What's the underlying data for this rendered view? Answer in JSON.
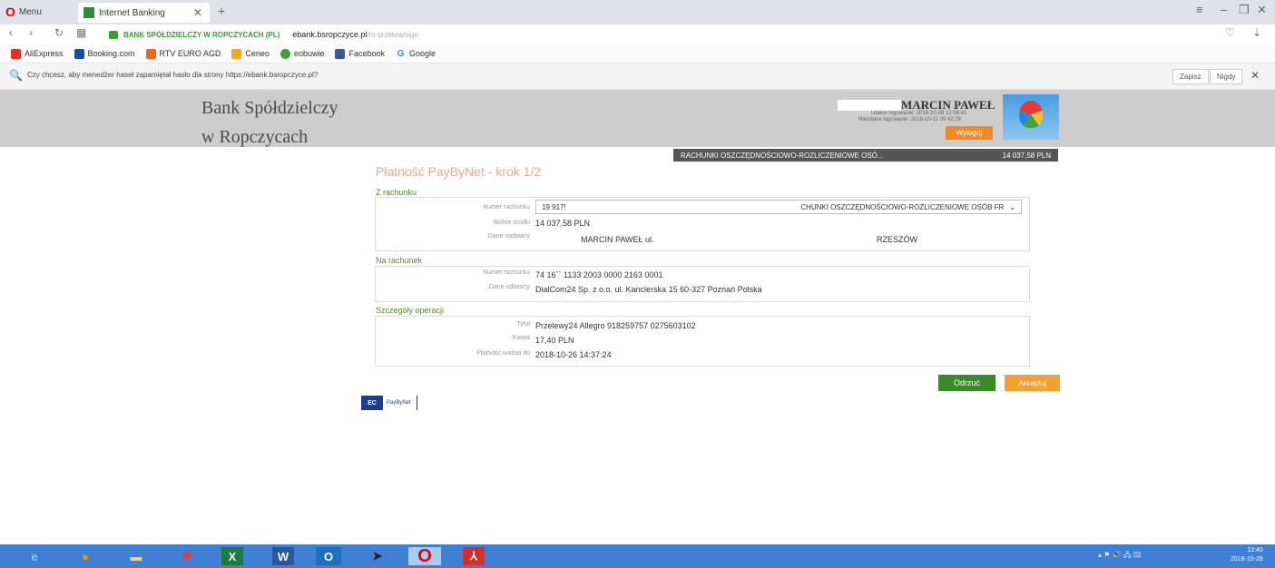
{
  "browser": {
    "menu_label": "Menu",
    "tab_title": "Internet Banking",
    "url_site_label": "BANK SPÓŁDZIELCZY W ROPCZYCACH (PL)",
    "url_host": "ebank.bsropczyce.pl",
    "url_path": "/rn-przelew/sign",
    "bookmarks": [
      "AliExpress",
      "Booking.com",
      "RTV EURO AGD",
      "Ceneo",
      "eobuwie",
      "Facebook",
      "Google"
    ],
    "password_prompt": "Czy chcesz, aby menedżer haseł zapamiętał hasło dla strony https://ebank.bsropczyce.pl?",
    "password_save": "Zapisz",
    "password_never": "Nigdy"
  },
  "header": {
    "bank_line1": "Bank Spółdzielczy",
    "bank_line2": "w Ropczycach",
    "user_name": "MARCIN PAWEŁ",
    "last_login_ok": "Udane logowanie: 2018-10-08 12:56:41",
    "last_login_fail": "Nieudane logowanie: 2018-10-11 09:42:26",
    "logout_label": "Wyloguj"
  },
  "account_strip": {
    "name": "RACHUNKI OSZCZĘDNOŚCIOWO-ROZLICZENIOWE OSÓ...",
    "balance": "14 037,58 PLN"
  },
  "page": {
    "title": "Płatność PayByNet - krok 1/2",
    "from_section": "Z rachunku",
    "from": {
      "account_label": "Numer rachunku",
      "account_value": "19 917!",
      "account_name": "CHUNKI OSZCZĘDNOŚCIOWO-ROZLICZENIOWE OSÓB FR",
      "funds_label": "Wolne środki",
      "funds_value": "14 037,58 PLN",
      "sender_label": "Dane nadawcy",
      "sender_value": "MARCIN PAWEŁ ul.",
      "sender_city": "RZESZÓW"
    },
    "to_section": "Na rachunek",
    "to": {
      "account_label": "Numer rachunku",
      "account_value": "74 16`` 1133 2003 0000 2163 0001",
      "recipient_label": "Dane odbiorcy",
      "recipient_value": "DialCom24 Sp. z o.o. ul. Kanclerska 15 60-327 Poznań Polska"
    },
    "details_section": "Szczegóły operacji",
    "details": {
      "title_label": "Tytuł",
      "title_value": "Przelewy24 Allegro 918259757 0275603102",
      "amount_label": "Kwota",
      "amount_value": "17,40 PLN",
      "valid_label": "Płatność ważna do",
      "valid_value": "2018-10-26 14:37:24"
    },
    "reject_label": "Odrzuć",
    "accept_label": "Akceptuj",
    "paybynet_label": "PayByNet"
  },
  "taskbar": {
    "apps": [
      "ie-icon",
      "firefox-icon",
      "explorer-icon",
      "adobe-icon",
      "excel-icon",
      "word-icon",
      "outlook-icon",
      "arrow-app-icon",
      "opera-icon",
      "pdf-icon"
    ],
    "time": "13:40",
    "date": "2018-10-26"
  },
  "colors": {
    "accent_orange": "#f08a24",
    "accent_green": "#3a8a2a",
    "header_gray": "#cdcdcd"
  }
}
